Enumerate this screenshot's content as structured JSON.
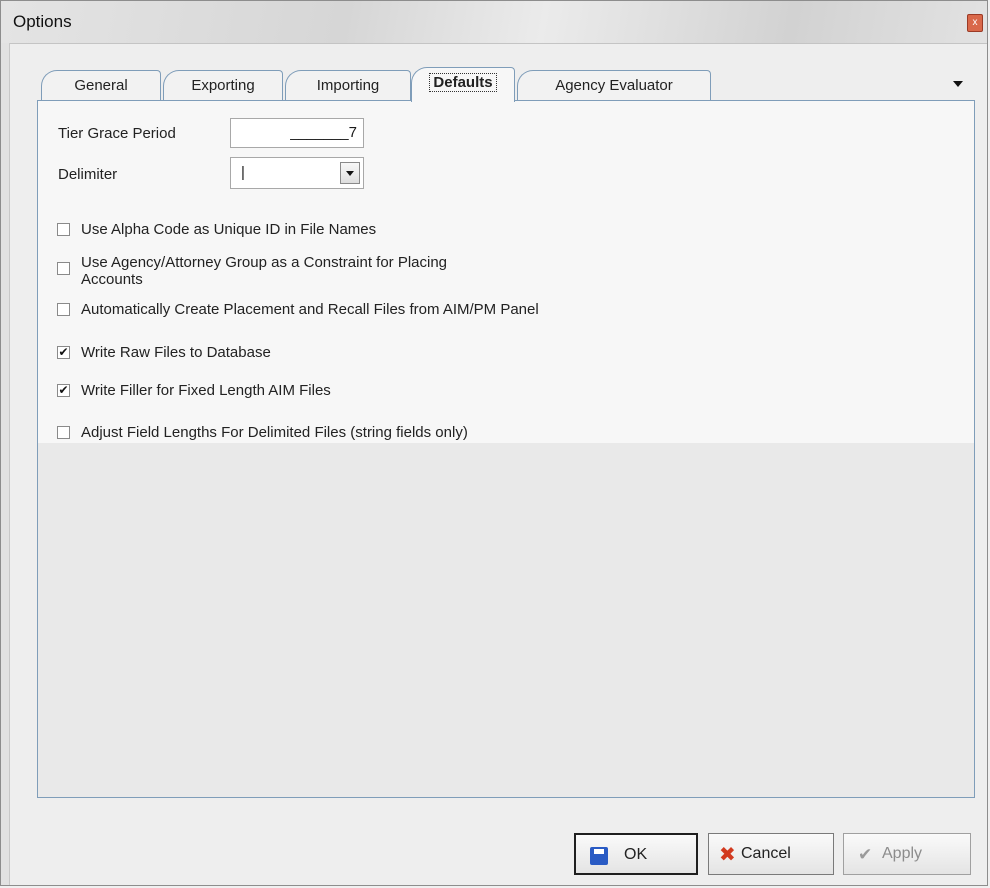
{
  "window": {
    "title": "Options",
    "close_glyph": "x"
  },
  "tabs": [
    {
      "label": "General",
      "active": false
    },
    {
      "label": "Exporting",
      "active": false
    },
    {
      "label": "Importing",
      "active": false
    },
    {
      "label": "Defaults",
      "active": true
    },
    {
      "label": "Agency Evaluator",
      "active": false
    }
  ],
  "fields": {
    "tier_grace_period": {
      "label": "Tier Grace Period",
      "value": "_______7"
    },
    "delimiter": {
      "label": "Delimiter",
      "value": "|"
    }
  },
  "options": [
    {
      "label": "Use Alpha Code as Unique ID in File Names",
      "checked": false
    },
    {
      "label_line1": "Use Agency/Attorney Group as a Constraint for Placing",
      "label_line2": "Accounts",
      "checked": false
    },
    {
      "label": "Automatically Create Placement and Recall Files from AIM/PM Panel",
      "checked": false
    },
    {
      "label": "Write Raw Files to Database",
      "checked": true
    },
    {
      "label": "Write Filler for Fixed Length AIM Files",
      "checked": true
    },
    {
      "label": "Adjust Field Lengths For Delimited Files (string fields only)",
      "checked": false
    }
  ],
  "buttons": {
    "ok": "OK",
    "cancel": "Cancel",
    "apply": "Apply"
  },
  "icons": {
    "ok": "save-icon",
    "cancel": "cancel-x-icon",
    "apply": "checkmark-icon",
    "check_glyph": "✔"
  }
}
